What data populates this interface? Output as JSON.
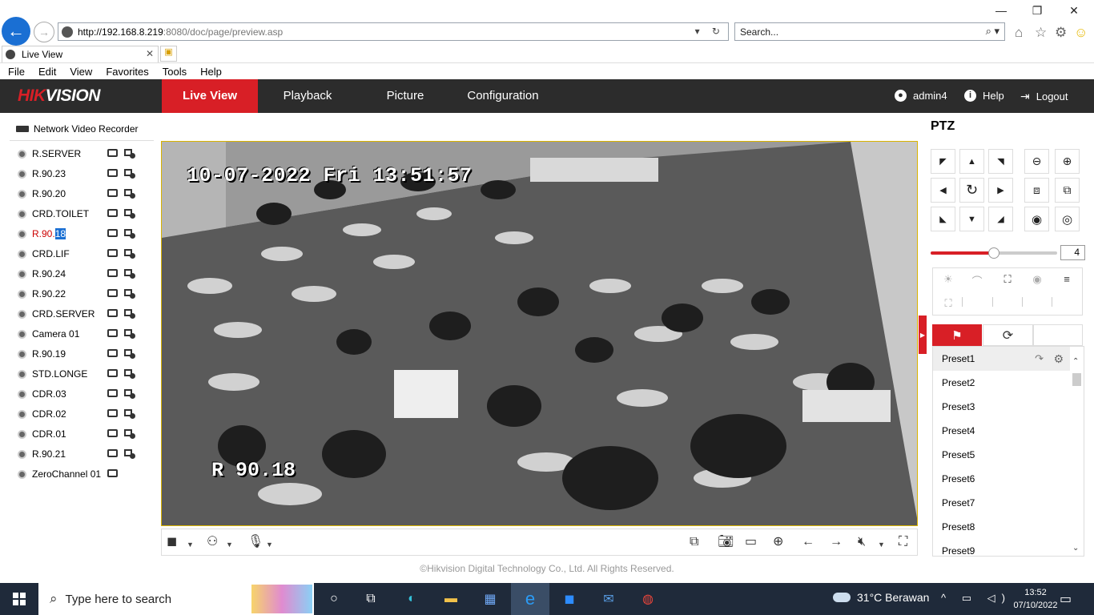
{
  "browser": {
    "address_host": "http://192.168.8.219",
    "address_rest": ":8080/doc/page/preview.asp",
    "search_placeholder": "Search...",
    "tab_title": "Live View",
    "menu": [
      "File",
      "Edit",
      "View",
      "Favorites",
      "Tools",
      "Help"
    ]
  },
  "app": {
    "brand": {
      "red": "HIK",
      "white": "VISION"
    },
    "nav": [
      "Live View",
      "Playback",
      "Picture",
      "Configuration"
    ],
    "active_nav": "Live View",
    "user": "admin4",
    "help": "Help",
    "logout": "Logout",
    "accent_color": "#d81f26"
  },
  "tree": {
    "root": "Network Video Recorder",
    "cameras": [
      {
        "name": "R.SERVER"
      },
      {
        "name": "R.90.23"
      },
      {
        "name": "R.90.20"
      },
      {
        "name": "CRD.TOILET"
      },
      {
        "name": "R.90.18",
        "name_plain": "R.90.",
        "name_hl": "18",
        "selected": true
      },
      {
        "name": "CRD.LIF"
      },
      {
        "name": "R.90.24"
      },
      {
        "name": "R.90.22"
      },
      {
        "name": "CRD.SERVER"
      },
      {
        "name": "Camera 01"
      },
      {
        "name": "R.90.19"
      },
      {
        "name": "STD.LONGE"
      },
      {
        "name": "CDR.03"
      },
      {
        "name": "CDR.02"
      },
      {
        "name": "CDR.01"
      },
      {
        "name": "R.90.21"
      },
      {
        "name": "ZeroChannel 01"
      }
    ]
  },
  "video": {
    "osd_time": "10-07-2022 Fri 13:51:57",
    "osd_name": "R 90.18"
  },
  "footer": "©Hikvision Digital Technology Co., Ltd. All Rights Reserved.",
  "ptz": {
    "title": "PTZ",
    "speed": 4,
    "speed_max": 7,
    "presets": [
      "Preset1",
      "Preset2",
      "Preset3",
      "Preset4",
      "Preset5",
      "Preset6",
      "Preset7",
      "Preset8",
      "Preset9"
    ]
  },
  "taskbar": {
    "search_placeholder": "Type here to search",
    "weather": "31°C  Berawan",
    "time": "13:52",
    "date": "07/10/2022"
  }
}
